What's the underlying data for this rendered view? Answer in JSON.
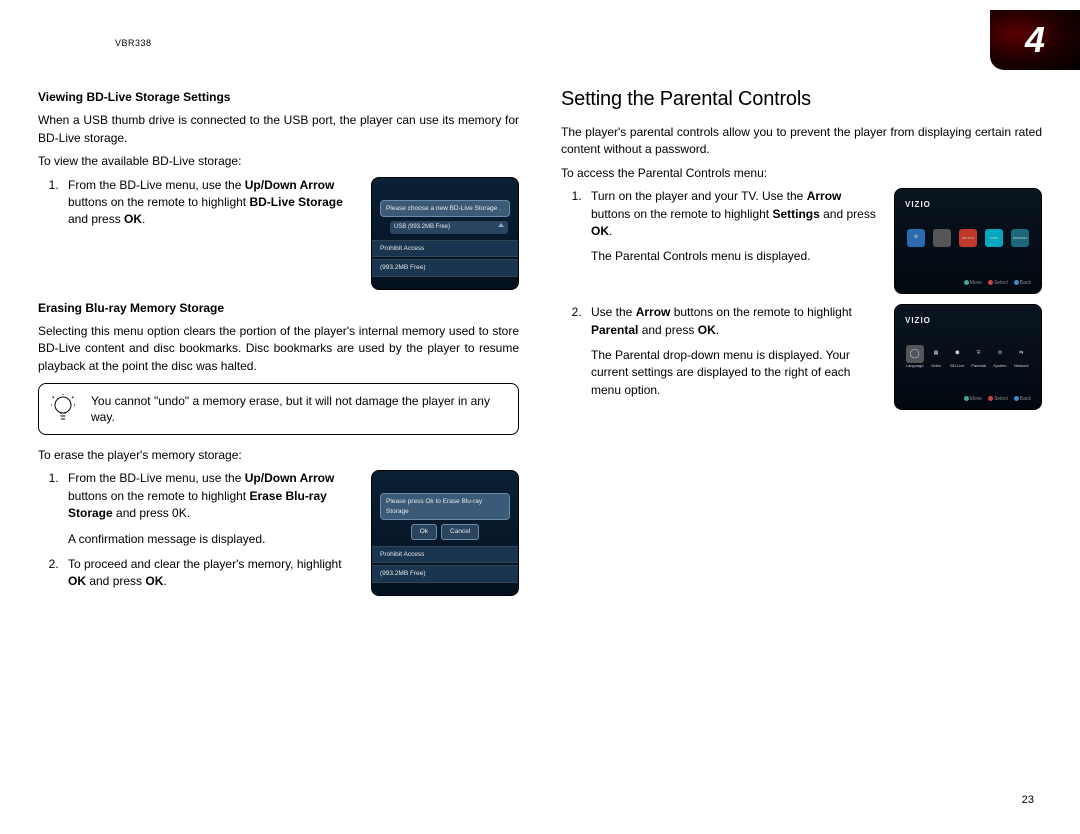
{
  "header": {
    "model": "VBR338",
    "chapter_number": "4",
    "page_number": "23"
  },
  "left": {
    "h1": "Viewing BD-Live Storage Settings",
    "p1": "When a USB thumb drive is connected to the USB port, the player can use its memory for BD-Live storage.",
    "p2": "To view the available BD-Live storage:",
    "step1_a": "From the BD-Live menu, use the ",
    "step1_b": "Up/Down Arrow",
    "step1_c": " buttons on the remote to highlight ",
    "step1_d": "BD-Live Storage",
    "step1_e": " and press ",
    "step1_f": "OK",
    "step1_g": ".",
    "screen1": {
      "bar": "Please choose a new BD-Live Storage .",
      "usb": "USB (993.2MB Free)",
      "line1": "Prohibit Access",
      "line2": "(993.2MB Free)"
    },
    "h2": "Erasing Blu-ray Memory Storage",
    "p3": "Selecting this menu option clears the portion of the player's internal memory used to store BD-Live content and disc bookmarks. Disc bookmarks are used by the player to resume playback at the point the disc was halted.",
    "tip": "You cannot \"undo\" a memory erase, but it will not damage the player in any way.",
    "p4": "To erase the player's memory storage:",
    "step2_a": "From the BD-Live menu, use the ",
    "step2_b": "Up/Down Arrow",
    "step2_c": " buttons on the remote to highlight ",
    "step2_d": "Erase Blu-ray Storage",
    "step2_e": " and press 0K.",
    "step2_p2": "A confirmation message is displayed.",
    "step3_a": "To proceed and clear the player's memory, highlight ",
    "step3_b": "OK",
    "step3_c": " and press ",
    "step3_d": "OK",
    "step3_e": ".",
    "screen2": {
      "bar": "Please press Ok to Erase Blu-ray Storage",
      "ok": "Ok",
      "cancel": "Cancel",
      "line1": "Prohibit Access",
      "line2": "(993.2MB Free)"
    }
  },
  "right": {
    "section": "Setting the Parental Controls",
    "p1": "The player's parental controls allow you to prevent the player from displaying certain rated content without a password.",
    "p2": "To access the Parental Controls menu:",
    "step1_a": "Turn on the player and your TV. Use the ",
    "step1_b": "Arrow",
    "step1_c": " buttons on the remote to highlight ",
    "step1_d": "Settings",
    "step1_e": " and press ",
    "step1_f": "OK",
    "step1_g": ".",
    "step1_p2": "The Parental Controls menu is displayed.",
    "screen1": {
      "logo": "VIZIO",
      "apps": [
        "Settings",
        "",
        "NETFLIX",
        "vudu",
        "PANDORA"
      ],
      "hints": [
        "Move",
        "Select",
        "Back"
      ]
    },
    "step2_a": "Use the ",
    "step2_b": "Arrow",
    "step2_c": " buttons on the remote to highlight ",
    "step2_d": "Parental",
    "step2_e": " and press ",
    "step2_f": "OK",
    "step2_g": ".",
    "step2_p2": "The Parental drop-down menu is displayed. Your current settings are displayed to the right of each menu option.",
    "screen2": {
      "logo": "VIZIO",
      "items": [
        "Language",
        "Video",
        "BD-Live",
        "Parental",
        "System",
        "Network"
      ],
      "hints": [
        "Move",
        "Select",
        "Back"
      ]
    }
  }
}
